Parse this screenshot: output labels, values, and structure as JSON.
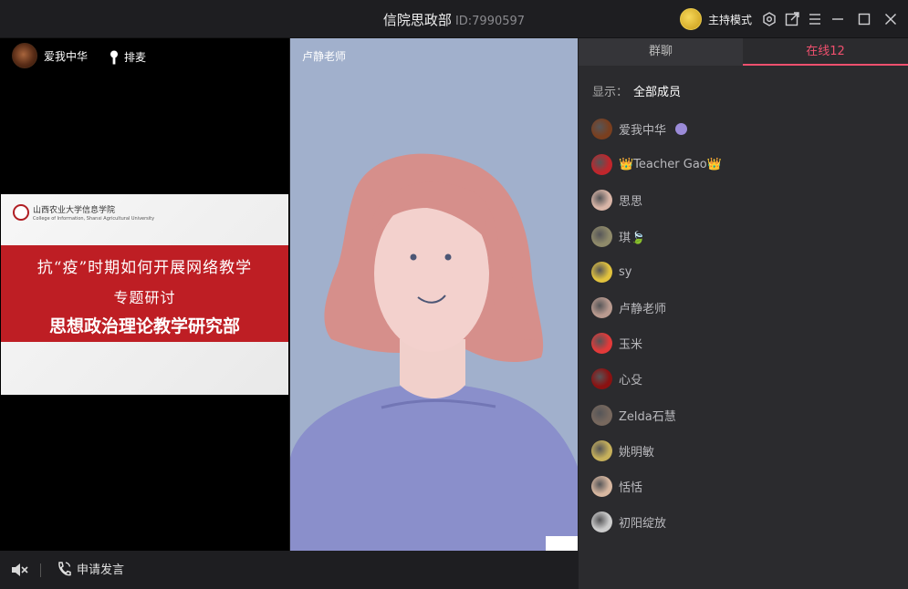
{
  "titlebar": {
    "room_name": "信院思政部",
    "room_id": "ID:7990597",
    "host_mode_label": "主持模式",
    "icons": [
      "settings-icon",
      "external-link-icon",
      "menu-icon",
      "minimize-icon",
      "maximize-icon",
      "close-icon"
    ]
  },
  "left_video": {
    "streamer_name": "爱我中华",
    "queue_label": "排麦",
    "slide": {
      "logo_text": "山西农业大学信息学院",
      "logo_sub": "College of Information, Shanxi Agricultural University",
      "line1": "抗“疫”时期如何开展网络教学",
      "line2": "专题研讨",
      "line3": "思想政治理论教学研究部"
    }
  },
  "center_video": {
    "label": "卢静老师"
  },
  "bottombar": {
    "apply_label": "申请发言"
  },
  "sidebar": {
    "tabs": [
      {
        "label": "群聊",
        "active": false
      },
      {
        "label": "在线12",
        "active": true
      }
    ],
    "filter_label": "显示：",
    "filter_value": "全部成员",
    "accent_color": "#f0506e",
    "members": [
      {
        "name": "爱我中华",
        "avatar": "#7a3f1f"
      },
      {
        "name": "👑Teacher Gao👑",
        "avatar": "#c0262c"
      },
      {
        "name": "思思",
        "avatar": "#d9b5a7"
      },
      {
        "name": "琪🍃",
        "avatar": "#8f8a6a"
      },
      {
        "name": "sy",
        "avatar": "#e1c23e"
      },
      {
        "name": "卢静老师",
        "avatar": "#b99a8f"
      },
      {
        "name": "玉米",
        "avatar": "#e23a3a"
      },
      {
        "name": "心殳",
        "avatar": "#8b1111"
      },
      {
        "name": "Zelda石慧",
        "avatar": "#77685e"
      },
      {
        "name": "姚明敏",
        "avatar": "#c6b05b"
      },
      {
        "name": "恬恬",
        "avatar": "#d7b7a0"
      },
      {
        "name": "初阳绽放",
        "avatar": "#cccccc"
      }
    ]
  }
}
